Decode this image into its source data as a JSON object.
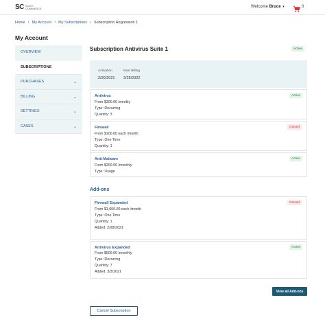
{
  "header": {
    "logo_mark": "SC",
    "logo_sub1": "SUITE",
    "logo_sub2": "COMMERCE",
    "welcome_prefix": "Welcome",
    "user_name": "Bruce",
    "cart_count": "0",
    "accent_color": "#d9312b"
  },
  "breadcrumb": [
    "Home",
    "My Account",
    "My Subscriptions",
    "Subscription Regression 1"
  ],
  "page_title": "My Account",
  "sidenav": [
    {
      "label": "OVERVIEW",
      "has_arrow": false
    },
    {
      "label": "SUBSCRIPTIONS",
      "has_arrow": false,
      "active": true
    },
    {
      "label": "PURCHASES",
      "has_arrow": true
    },
    {
      "label": "BILLING",
      "has_arrow": true
    },
    {
      "label": "SETTINGS",
      "has_arrow": true
    },
    {
      "label": "CASES",
      "has_arrow": true
    }
  ],
  "subscription": {
    "title": "Subscription Antivirus Suite 1",
    "status": "Active",
    "activation_label": "Activation",
    "activation_value": "2/20/2021",
    "next_billing_label": "Next Billing",
    "next_billing_value": "2/25/2022"
  },
  "lines": [
    {
      "name": "Antivirus",
      "status": "Active",
      "details": [
        "From $300.00 /weekly",
        "Type: Recurring",
        "Quantity: 3"
      ]
    },
    {
      "name": "Firewall",
      "status": "Closed",
      "details": [
        "From $100.00 each /month",
        "Type: One Time",
        "Quantity: 1"
      ]
    },
    {
      "name": "Anti-Malware",
      "status": "Active",
      "details": [
        "From $200.00 /monthly",
        "Type: Usage"
      ]
    }
  ],
  "addons_heading": "Add-ons",
  "addons": [
    {
      "name": "Firewall Expanded",
      "status": "Closed",
      "details": [
        "From $1,000.00 each /month",
        "Type: One Time",
        "Quantity: 1",
        "Added: 2/28/2021"
      ]
    },
    {
      "name": "Antivirus Expanded",
      "status": "Active",
      "details": [
        "From $500.00 /monthly",
        "Type: Recurring",
        "Quantity: 7",
        "Added: 3/3/2021"
      ]
    }
  ],
  "buttons": {
    "view_all_addons": "View all Add-ons",
    "cancel_subscription": "Cancel Subscription"
  }
}
